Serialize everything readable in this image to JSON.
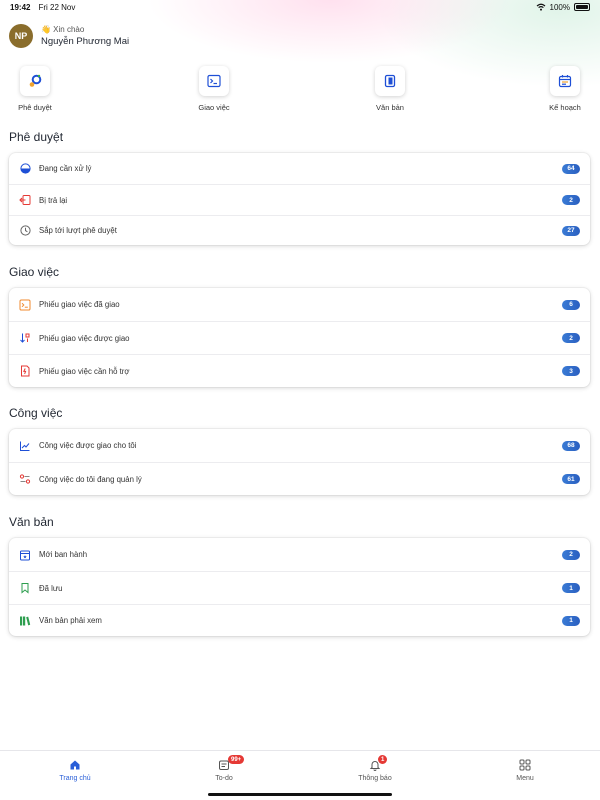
{
  "status_bar": {
    "time": "19:42",
    "date": "Fri 22 Nov",
    "battery": "100%"
  },
  "user": {
    "initials": "NP",
    "greeting": "👋 Xin chào",
    "name": "Nguyễn Phương Mai"
  },
  "shortcuts": [
    {
      "label": "Phê duyệt",
      "icon": "approval-icon"
    },
    {
      "label": "Giao việc",
      "icon": "terminal-icon"
    },
    {
      "label": "Văn bản",
      "icon": "document-icon"
    },
    {
      "label": "Kế hoạch",
      "icon": "calendar-icon"
    }
  ],
  "sections": {
    "approval": {
      "title": "Phê duyệt",
      "items": [
        {
          "label": "Đang cần xử lý",
          "count": "64",
          "icon": "half-circle-icon"
        },
        {
          "label": "Bị trả lại",
          "count": "2",
          "icon": "return-icon"
        },
        {
          "label": "Sắp tới lượt phê duyệt",
          "count": "27",
          "icon": "clock-icon"
        }
      ]
    },
    "assign": {
      "title": "Giao việc",
      "items": [
        {
          "label": "Phiếu giao việc đã giao",
          "count": "6",
          "icon": "terminal-icon"
        },
        {
          "label": "Phiếu giao việc được giao",
          "count": "2",
          "icon": "sort-icon"
        },
        {
          "label": "Phiếu giao việc cần hỗ trợ",
          "count": "3",
          "icon": "support-file-icon"
        }
      ]
    },
    "work": {
      "title": "Công việc",
      "items": [
        {
          "label": "Công việc được giao cho tôi",
          "count": "68",
          "icon": "trend-icon"
        },
        {
          "label": "Công việc do tôi đang quản lý",
          "count": "61",
          "icon": "manage-icon"
        }
      ]
    },
    "docs": {
      "title": "Văn bản",
      "items": [
        {
          "label": "Mới ban hành",
          "count": "2",
          "icon": "new-calendar-icon"
        },
        {
          "label": "Đã lưu",
          "count": "1",
          "icon": "bookmark-icon"
        },
        {
          "label": "Văn bản phải xem",
          "count": "1",
          "icon": "books-icon"
        }
      ]
    }
  },
  "tabbar": [
    {
      "label": "Trang chủ",
      "icon": "home-icon",
      "active": true
    },
    {
      "label": "To-do",
      "icon": "todo-icon",
      "badge": "99+"
    },
    {
      "label": "Thông báo",
      "icon": "bell-icon",
      "badge": "1"
    },
    {
      "label": "Menu",
      "icon": "grid-icon"
    }
  ],
  "colors": {
    "accent": "#2a5fd8",
    "badge": "#2f6bd0",
    "alert": "#e53935"
  }
}
